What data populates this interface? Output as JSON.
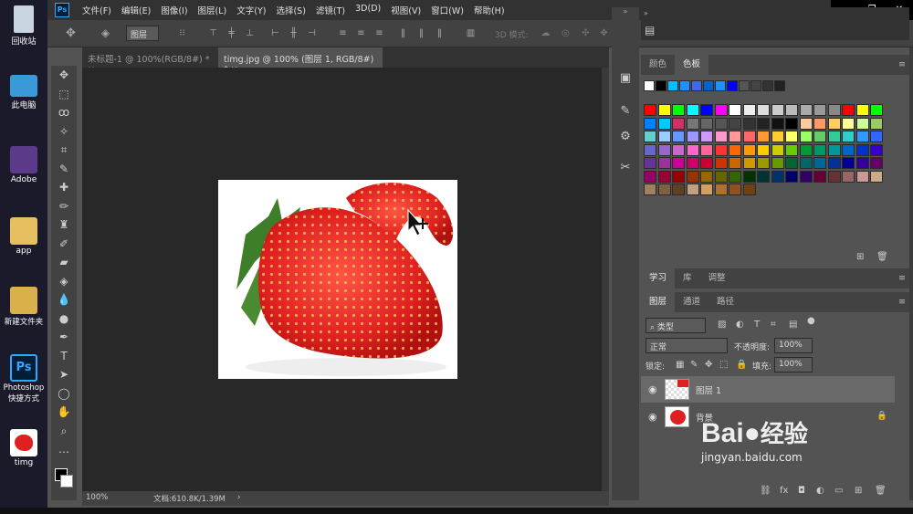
{
  "desktop": {
    "icons": [
      "回收站",
      "此电脑",
      "Adobe",
      "app",
      "新建文件夹",
      "Photoshop 快捷方式",
      "timg"
    ]
  },
  "ps": {
    "logo": "Ps",
    "menus": [
      "文件(F)",
      "编辑(E)",
      "图像(I)",
      "图层(L)",
      "文字(Y)",
      "选择(S)",
      "滤镜(T)",
      "3D(D)",
      "视图(V)",
      "窗口(W)",
      "帮助(H)"
    ],
    "options": {
      "layer_select": "图层",
      "mode3d": "3D 模式:"
    },
    "tabs": [
      "未标题-1 @ 100%(RGB/8#) *",
      "timg.jpg @ 100% (图层 1, RGB/8#) *"
    ],
    "status": {
      "zoom": "100%",
      "doc": "文档:610.8K/1.39M"
    },
    "swatches": {
      "tabs": [
        "颜色",
        "色板"
      ],
      "active": "色板"
    },
    "learn_tabs": [
      "学习",
      "库",
      "调整"
    ],
    "layers_panel": {
      "tabs": [
        "图层",
        "通道",
        "路径"
      ],
      "filter_kind": "类型",
      "blend_mode": "正常",
      "opacity_label": "不透明度:",
      "opacity": "100%",
      "lock_label": "锁定:",
      "fill_label": "填充:",
      "fill": "100%",
      "layers": [
        {
          "name": "图层 1"
        },
        {
          "name": "背景"
        }
      ]
    }
  },
  "watermark": {
    "brand": "Bai",
    "brand2": "经验",
    "url": "jingyan.baidu.com"
  },
  "colors": {
    "swatch_row1": [
      "#ffffff",
      "#000000",
      "#00bfff",
      "#1e90ff",
      "#4169e1",
      "#0066cc",
      "#1e90ff",
      "#0000ff",
      "#555555",
      "#444444",
      "#333333",
      "#222222"
    ],
    "grid": [
      [
        "#ff0000",
        "#ffff00",
        "#00ff00",
        "#00ffff",
        "#0000ff",
        "#ff00ff",
        "#ffffff",
        "#eeeeee",
        "#dddddd",
        "#cccccc",
        "#bbbbbb",
        "#aaaaaa",
        "#999999",
        "#888888",
        "#ff0000",
        "#ffff00",
        "#00ff00"
      ],
      [
        "#0080ff",
        "#00ccff",
        "#cc3366",
        "#777777",
        "#666666",
        "#555555",
        "#444444",
        "#333333",
        "#222222",
        "#111111",
        "#000000",
        "#ffcc99",
        "#ff9966",
        "#ffcc66",
        "#ffff99",
        "#ccff99",
        "#99cc66"
      ],
      [
        "#66cccc",
        "#99ccff",
        "#6699ff",
        "#9999ff",
        "#cc99ff",
        "#ff99cc",
        "#ff9999",
        "#ff6666",
        "#ff9933",
        "#ffcc33",
        "#ffff66",
        "#99ff66",
        "#66cc66",
        "#33cc99",
        "#33cccc",
        "#3399ff",
        "#3366ff"
      ],
      [
        "#6666cc",
        "#9966cc",
        "#cc66cc",
        "#ff66cc",
        "#ff6699",
        "#ff3333",
        "#ff6600",
        "#ff9900",
        "#ffcc00",
        "#cccc00",
        "#66cc00",
        "#009933",
        "#009966",
        "#009999",
        "#0066cc",
        "#0033cc",
        "#3300cc"
      ],
      [
        "#663399",
        "#993399",
        "#cc0099",
        "#cc0066",
        "#cc0033",
        "#cc3300",
        "#cc6600",
        "#cc9900",
        "#999900",
        "#669900",
        "#006633",
        "#006666",
        "#006699",
        "#003399",
        "#000099",
        "#330099",
        "#660066"
      ],
      [
        "#990066",
        "#990033",
        "#990000",
        "#993300",
        "#996600",
        "#666600",
        "#336600",
        "#003300",
        "#003333",
        "#003366",
        "#000066",
        "#330066",
        "#660033",
        "#663333",
        "#996666",
        "#cc9999",
        "#ccaa88"
      ],
      [
        "#a08060",
        "#806040",
        "#604020",
        "#c0a080",
        "#d0a060",
        "#b07030",
        "#905020",
        "#704010"
      ]
    ]
  }
}
